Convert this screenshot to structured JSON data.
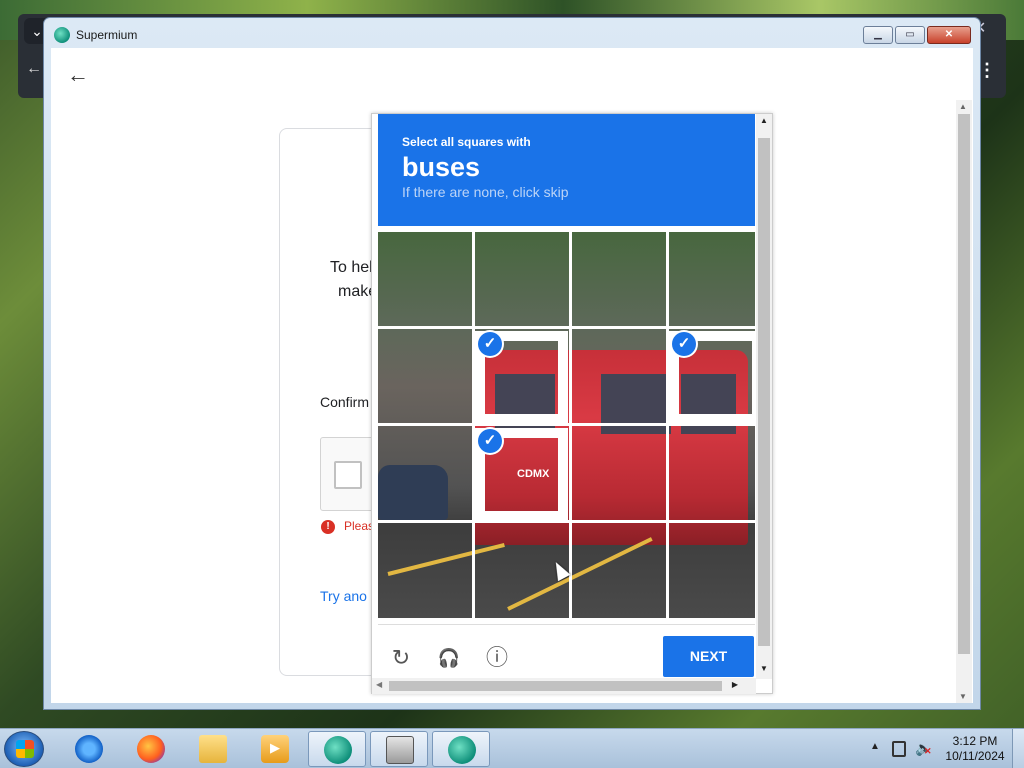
{
  "window": {
    "title": "Supermium",
    "btn_min": "▁",
    "btn_max": "▭",
    "btn_close": "✕",
    "icon": "supermium-icon"
  },
  "browser": {
    "back_glyph": "←"
  },
  "google_page": {
    "text_line1": "To hel",
    "text_line2": "make",
    "confirm_label": "Confirm",
    "error_text": "Pleas",
    "try_link": "Try ano"
  },
  "recaptcha": {
    "instruction": "Select all squares with",
    "target": "buses",
    "hint": "If there are none, click skip",
    "bus_logo": "CDMX",
    "selected_tiles": [
      {
        "row": 1,
        "col": 1
      },
      {
        "row": 1,
        "col": 3
      },
      {
        "row": 2,
        "col": 1
      }
    ],
    "grid": {
      "rows": 4,
      "cols": 4
    },
    "reload_icon": "↻",
    "audio_icon": "🎧",
    "info_icon": "ⓘ",
    "next_label": "NEXT",
    "accent": "#1a73e8"
  },
  "taskbar": {
    "items": [
      "ie-icon",
      "firefox-icon",
      "explorer-icon",
      "media-player-icon",
      "supermium-user-icon",
      "webcam-icon",
      "supermium-icon"
    ],
    "clock_time": "3:12 PM",
    "clock_date": "10/11/2024"
  }
}
